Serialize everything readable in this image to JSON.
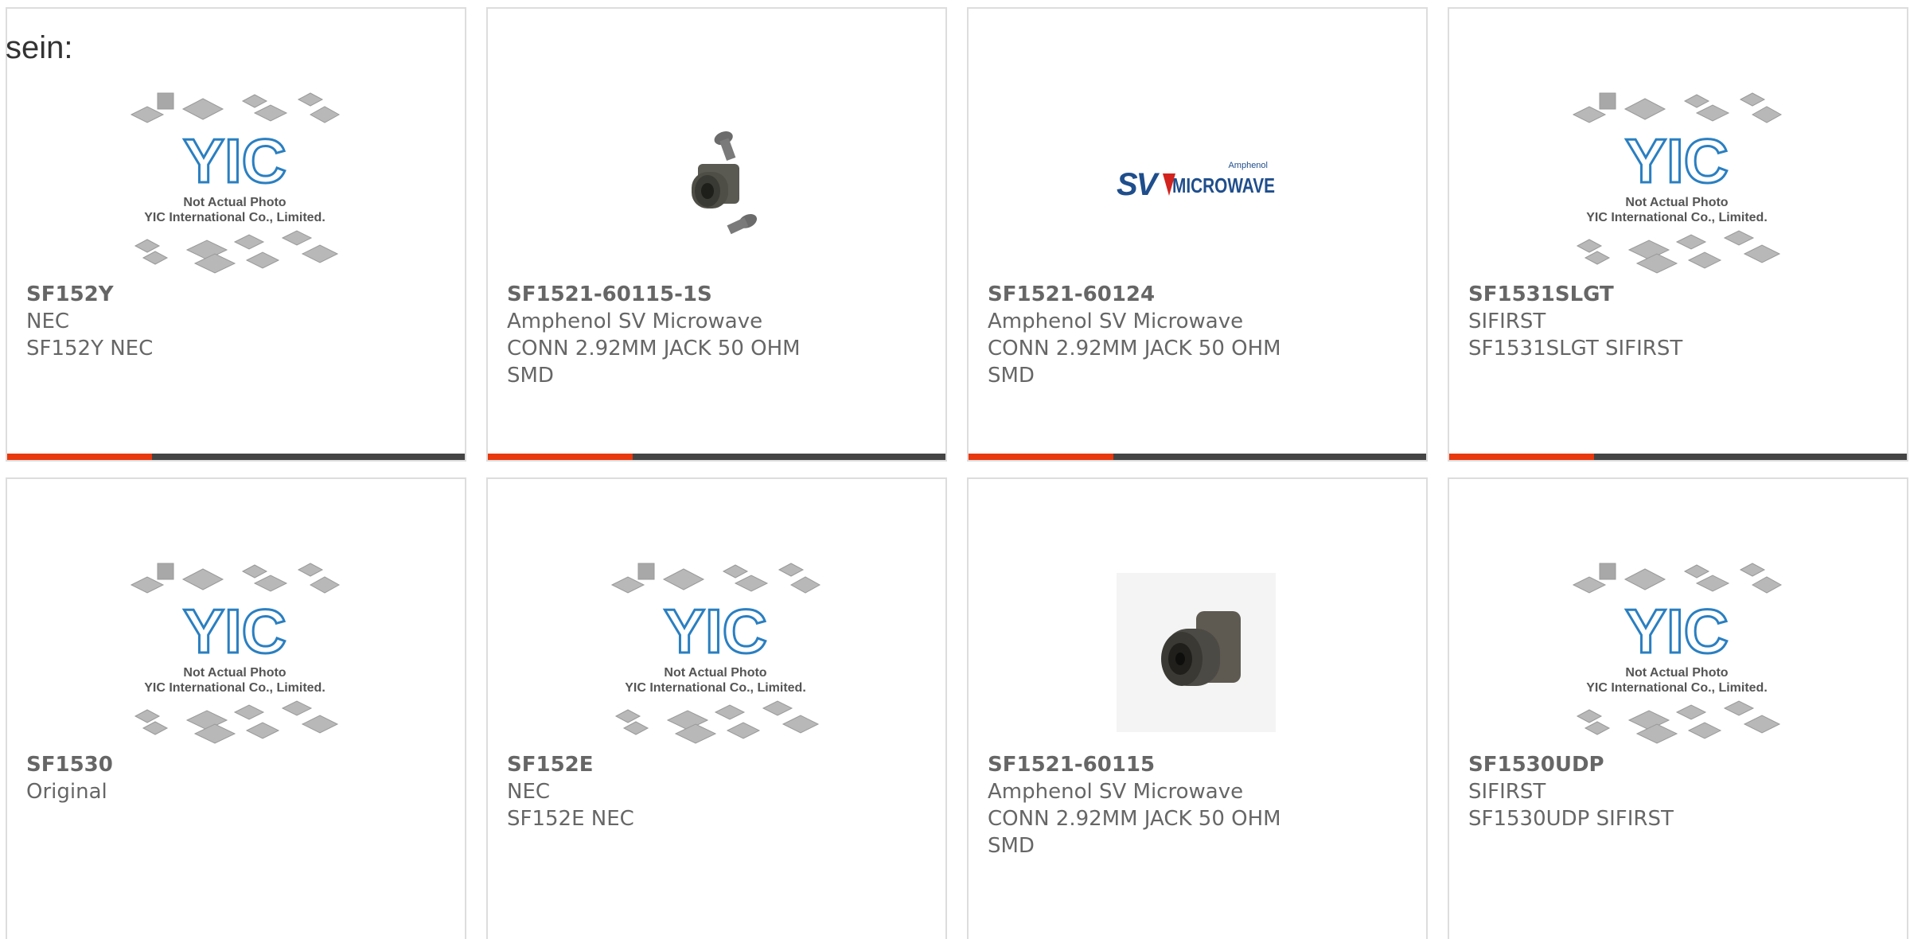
{
  "intro_text": "sein:",
  "placeholder": {
    "line1": "Not Actual Photo",
    "line2": "YIC International Co., Limited.",
    "logo": "YIC"
  },
  "sv_logo": {
    "small": "Amphenol",
    "mark": "SV",
    "word": "MICROWAVE"
  },
  "colors": {
    "accent": "#e8380d",
    "bar": "#444444",
    "yic_blue": "#2a7fc1"
  },
  "products": [
    {
      "part_number": "SF152Y",
      "manufacturer": "NEC",
      "description": "SF152Y NEC",
      "image": "placeholder"
    },
    {
      "part_number": "SF1521-60115-1S",
      "manufacturer": "Amphenol SV Microwave",
      "description": "CONN 2.92MM JACK 50 OHM SMD",
      "image": "connector-with-screws"
    },
    {
      "part_number": "SF1521-60124",
      "manufacturer": "Amphenol SV Microwave",
      "description": "CONN 2.92MM JACK 50 OHM SMD",
      "image": "sv-microwave-logo"
    },
    {
      "part_number": "SF1531SLGT",
      "manufacturer": "SIFIRST",
      "description": "SF1531SLGT SIFIRST",
      "image": "placeholder"
    },
    {
      "part_number": "SF1530",
      "manufacturer": "Original",
      "description": "",
      "image": "placeholder"
    },
    {
      "part_number": "SF152E",
      "manufacturer": "NEC",
      "description": "SF152E NEC",
      "image": "placeholder"
    },
    {
      "part_number": "SF1521-60115",
      "manufacturer": "Amphenol SV Microwave",
      "description": "CONN 2.92MM JACK 50 OHM SMD",
      "image": "connector"
    },
    {
      "part_number": "SF1530UDP",
      "manufacturer": "SIFIRST",
      "description": "SF1530UDP SIFIRST",
      "image": "placeholder"
    }
  ]
}
